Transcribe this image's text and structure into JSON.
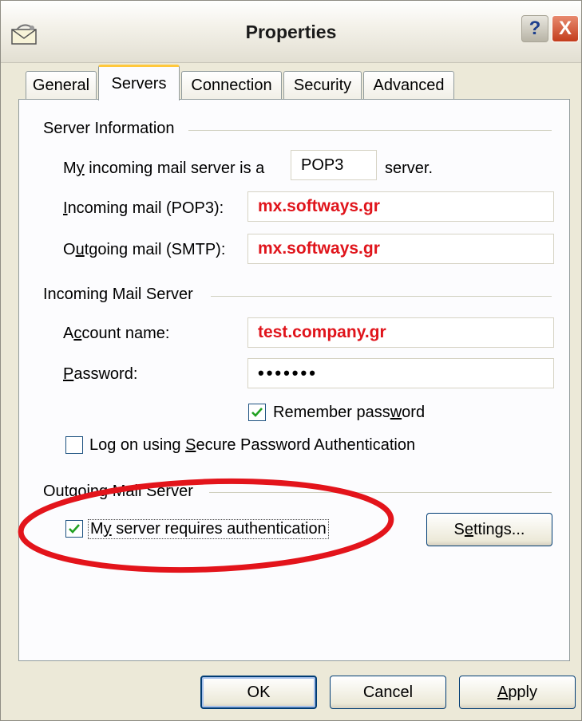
{
  "window": {
    "title": "Properties",
    "help_label": "?",
    "close_label": "X"
  },
  "tabs": [
    {
      "label": "General"
    },
    {
      "label": "Servers"
    },
    {
      "label": "Connection"
    },
    {
      "label": "Security"
    },
    {
      "label": "Advanced"
    }
  ],
  "active_tab": "Servers",
  "server_information": {
    "title": "Server Information",
    "incoming_type_label_pre": "M",
    "incoming_type_label_ul": "y",
    "incoming_type_label_post": " incoming mail server is a",
    "incoming_type_value": "POP3",
    "incoming_type_suffix": "server.",
    "incoming_label_ul": "I",
    "incoming_label_post": "ncoming mail (POP3):",
    "incoming_value": "mx.softways.gr",
    "outgoing_label_pre": "O",
    "outgoing_label_ul": "u",
    "outgoing_label_post": "tgoing mail (SMTP):",
    "outgoing_value": "mx.softways.gr"
  },
  "incoming_mail_server": {
    "title": "Incoming Mail Server",
    "account_label_pre": "A",
    "account_label_ul": "c",
    "account_label_post": "count name:",
    "account_value": "test.company.gr",
    "password_label_ul": "P",
    "password_label_post": "assword:",
    "password_value": "•••••••",
    "remember_label_pre": "Remember pass",
    "remember_label_ul": "w",
    "remember_label_post": "ord",
    "remember_checked": true,
    "spa_label_pre": "Log on using ",
    "spa_label_ul": "S",
    "spa_label_post": "ecure Password Authentication",
    "spa_checked": false
  },
  "outgoing_mail_server": {
    "title": "Outgoing Mail Server",
    "auth_label_pre": "M",
    "auth_label_ul": "y",
    "auth_label_post": " server requires authentication",
    "auth_checked": true,
    "settings_label_pre": "S",
    "settings_label_ul": "e",
    "settings_label_post": "ttings..."
  },
  "footer": {
    "ok_label": "OK",
    "cancel_label": "Cancel",
    "apply_label_ul": "A",
    "apply_label_post": "pply"
  },
  "colors": {
    "highlight_ellipse": "#e3141b",
    "field_value_text": "#e0141b",
    "dialog_background": "#ece9d8",
    "active_tab_accent": "#ffc83c"
  },
  "icons": {
    "title": "mail-envelope-icon",
    "checkbox": "checkmark-icon"
  }
}
